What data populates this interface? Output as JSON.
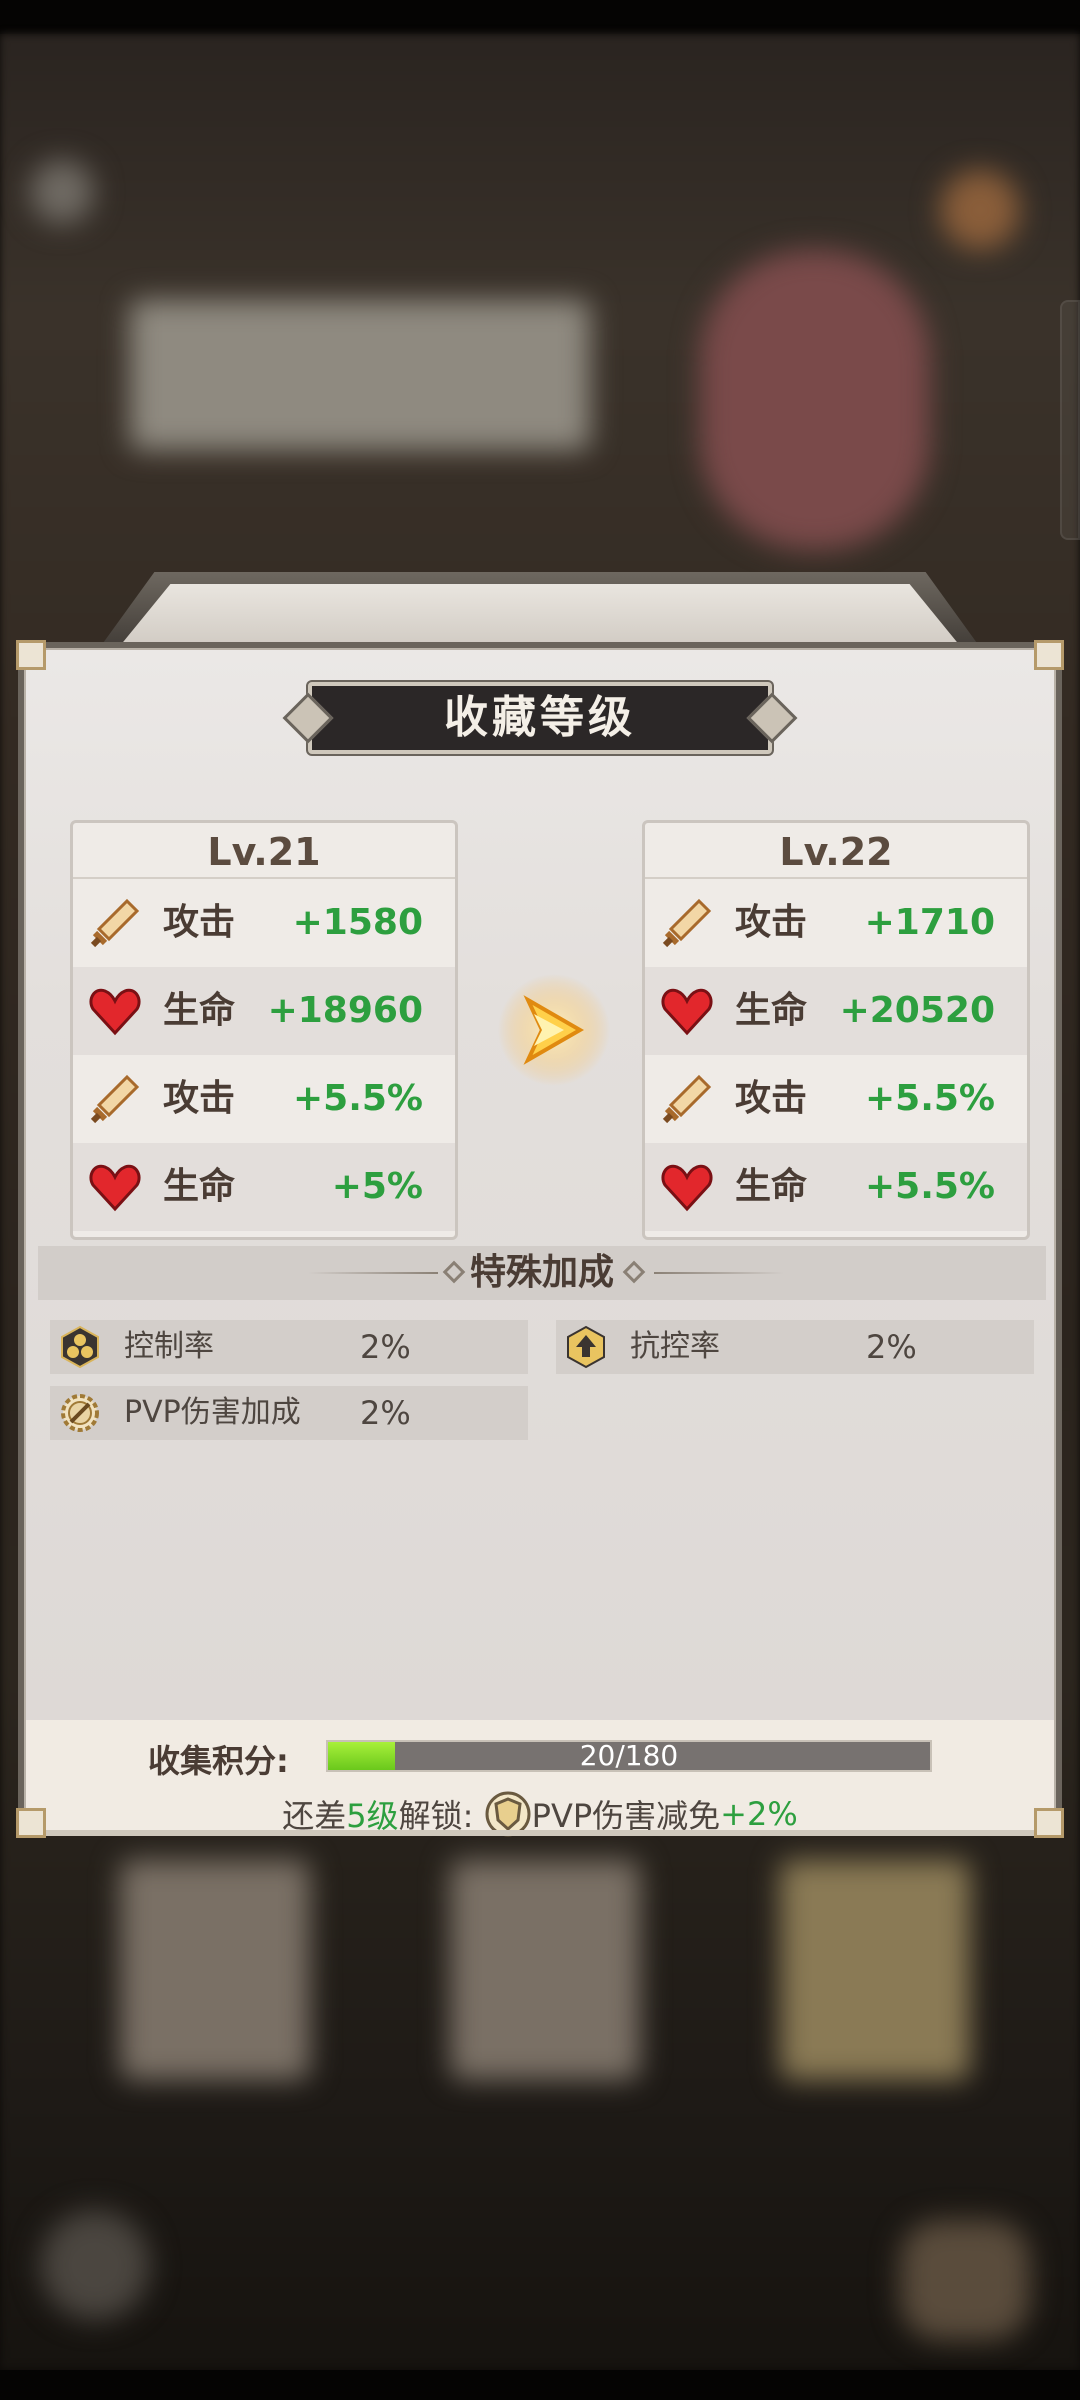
{
  "dialog": {
    "title": "收藏等级",
    "current": {
      "level": "Lv.21",
      "stats": [
        {
          "icon": "sword-icon",
          "name": "攻击",
          "value": "+1580"
        },
        {
          "icon": "heart-icon",
          "name": "生命",
          "value": "+18960"
        },
        {
          "icon": "sword-icon",
          "name": "攻击",
          "value": "+5.5%"
        },
        {
          "icon": "heart-icon",
          "name": "生命",
          "value": "+5%"
        }
      ]
    },
    "next": {
      "level": "Lv.22",
      "stats": [
        {
          "icon": "sword-icon",
          "name": "攻击",
          "value": "+1710"
        },
        {
          "icon": "heart-icon",
          "name": "生命",
          "value": "+20520"
        },
        {
          "icon": "sword-icon",
          "name": "攻击",
          "value": "+5.5%"
        },
        {
          "icon": "heart-icon",
          "name": "生命",
          "value": "+5.5%"
        }
      ]
    },
    "special": {
      "title": "特殊加成",
      "bonuses": [
        {
          "icon": "hexagon-cluster-icon",
          "name": "控制率",
          "value": "2%"
        },
        {
          "icon": "hexagon-shield-icon",
          "name": "抗控率",
          "value": "2%"
        },
        {
          "icon": "gear-sword-icon",
          "name": "PVP伤害加成",
          "value": "2%"
        }
      ]
    },
    "collection": {
      "label": "收集积分:",
      "progress_text": "20/180",
      "progress_fraction": 0.111
    },
    "unlock": {
      "prefix": "还差",
      "levels": "5级",
      "middle": "解锁:",
      "reward": "PVP伤害减免",
      "reward_value": "+2%"
    }
  },
  "colors": {
    "value_green": "#2d9f3f",
    "progress_fill": "#8ee02a",
    "title_plate": "#2b2727"
  }
}
